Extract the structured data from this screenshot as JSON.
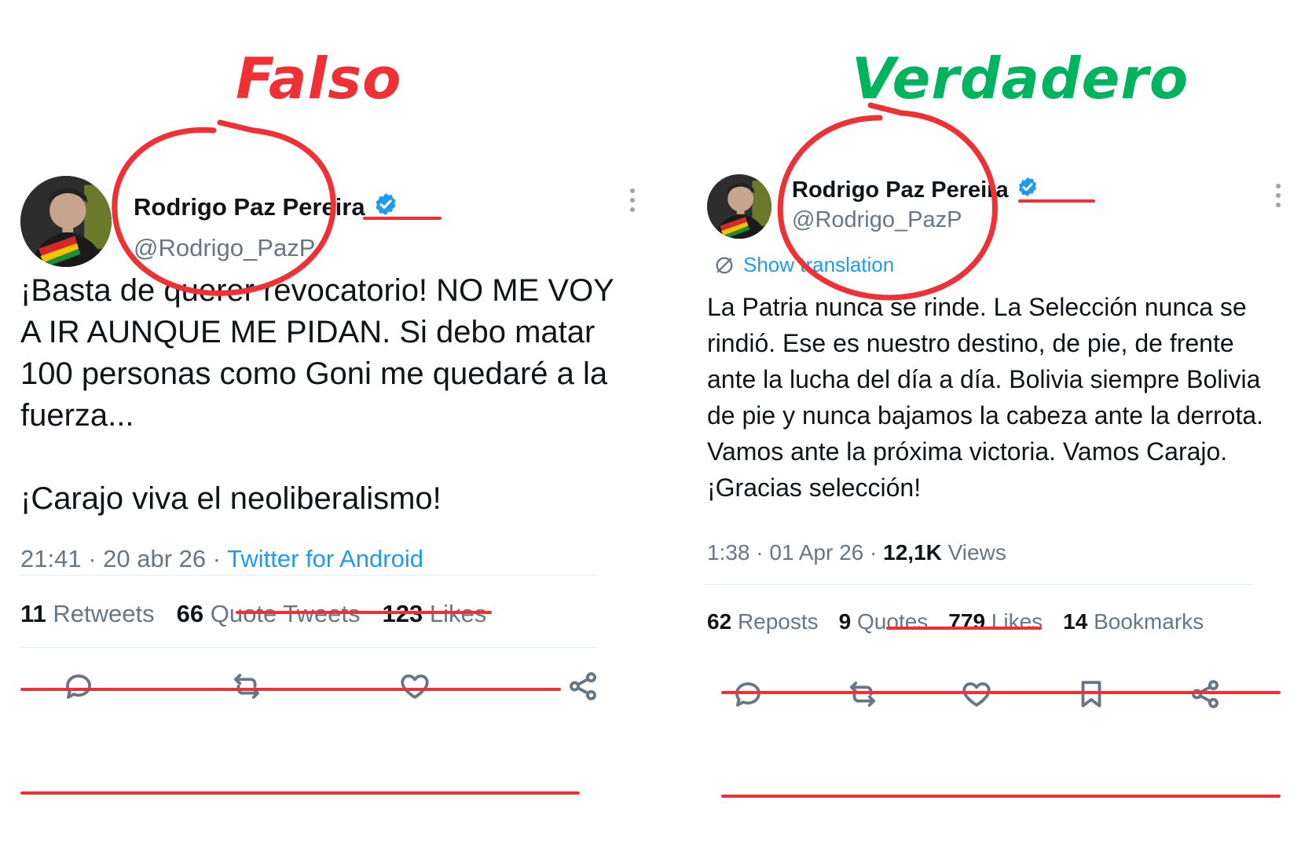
{
  "labels": {
    "fake": "Falso",
    "real": "Verdadero"
  },
  "colors": {
    "fake": "#ef3135",
    "real": "#00b35f",
    "link": "#1d9bf0",
    "muted": "#657786",
    "annotation": "#ef3135"
  },
  "fake_tweet": {
    "name": "Rodrigo Paz Pereira",
    "handle": "@Rodrigo_PazP",
    "body": "¡Basta de querer revocatorio! NO ME VOY A IR AUNQUE ME PIDAN. Si debo matar 100 personas como Goni me quedaré a la fuerza...\n\n¡Carajo viva el neoliberalismo!",
    "time": "21:41 · 20 abr 26 · ",
    "source": "Twitter for Android",
    "stats": [
      {
        "num": "11",
        "label": "Retweets"
      },
      {
        "num": "66",
        "label": "Quote Tweets"
      },
      {
        "num": "123",
        "label": "Likes"
      }
    ],
    "actions": [
      "reply-icon",
      "retweet-icon",
      "like-icon",
      "share-icon"
    ]
  },
  "real_tweet": {
    "name": "Rodrigo Paz Pereira",
    "handle": "@Rodrigo_PazP",
    "translate": "Show translation",
    "body": "La Patria nunca se rinde. La Selección nunca se rindió. Ese es nuestro destino, de pie, de frente ante la lucha del día a día. Bolivia siempre Bolivia de pie y nunca bajamos la cabeza ante la derrota. Vamos ante la próxima victoria. Vamos Carajo. ¡Gracias selección!",
    "time": "1:38 · 01 Apr 26 · ",
    "views_count": "12,1K",
    "views_label": " Views",
    "stats": [
      {
        "num": "62",
        "label": "Reposts"
      },
      {
        "num": "9",
        "label": "Quotes"
      },
      {
        "num": "779",
        "label": "Likes"
      },
      {
        "num": "14",
        "label": "Bookmarks"
      }
    ],
    "actions": [
      "reply-icon",
      "repost-icon",
      "like-icon",
      "bookmark-icon",
      "share-icon"
    ]
  }
}
